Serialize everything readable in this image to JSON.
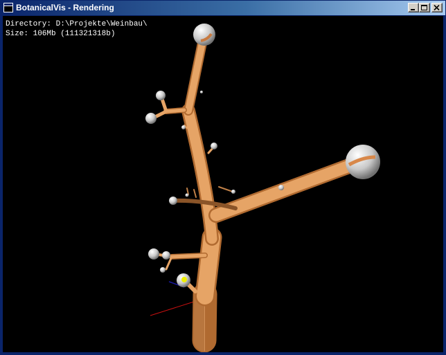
{
  "window": {
    "title": "BotanicalVis - Rendering",
    "accent": "#0A246A"
  },
  "controls": {
    "minimize_icon": "minimize-icon",
    "maximize_icon": "maximize-icon",
    "close_icon": "close-icon"
  },
  "viewport": {
    "background": "#000000",
    "directory_line": "Directory: D:\\Projekte\\Weinbau\\",
    "size_line": "Size: 106Mb (111321318b)"
  },
  "scene": {
    "branch_color": "#E2A064",
    "node_color": "#D8D8D8"
  }
}
